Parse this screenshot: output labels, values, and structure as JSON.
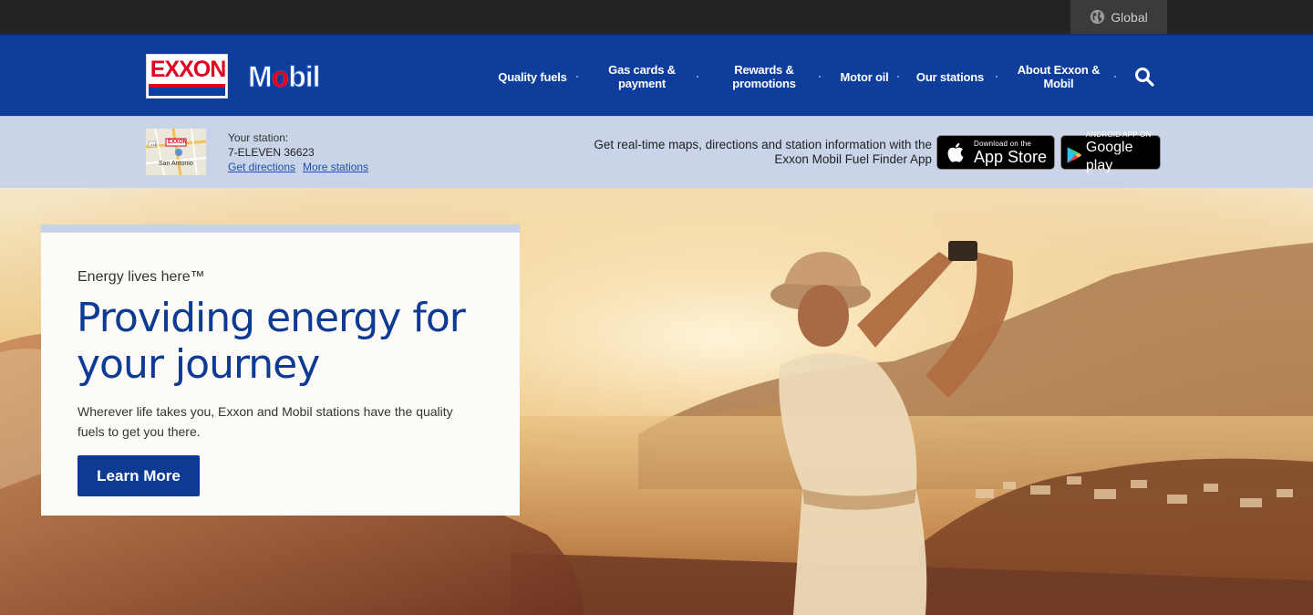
{
  "topbar": {
    "global_label": "Global"
  },
  "header": {
    "logo_exxon": "EXXON",
    "logo_mobil_pre": "M",
    "logo_mobil_o": "o",
    "logo_mobil_post": "bil",
    "nav": [
      {
        "label": "Quality fuels"
      },
      {
        "label": "Gas cards & payment"
      },
      {
        "label": "Rewards & promotions"
      },
      {
        "label": "Motor oil"
      },
      {
        "label": "Our stations"
      },
      {
        "label": "About Exxon & Mobil"
      }
    ]
  },
  "station": {
    "map_label": "San Antonio",
    "map_badge": "EXXON",
    "label": "Your station:",
    "name": "7-ELEVEN 36623",
    "get_directions": "Get directions",
    "more_stations": "More stations"
  },
  "app_promo": {
    "line1": "Get real-time maps, directions and station information with the",
    "line2": "Exxon Mobil Fuel Finder App",
    "appstore_small": "Download on the",
    "appstore_big": "App Store",
    "googleplay_small": "ANDROID APP ON",
    "googleplay_big": "Google play"
  },
  "hero": {
    "eyebrow": "Energy lives here™",
    "headline": "Providing energy for your journey",
    "body": "Wherever life takes you, Exxon and Mobil stations have the quality fuels to get you there.",
    "cta": "Learn More"
  },
  "colors": {
    "brand_blue": "#0f3d9c",
    "exxon_red": "#e1001f",
    "station_bar": "#c9d4e8",
    "topbar": "#232323"
  }
}
